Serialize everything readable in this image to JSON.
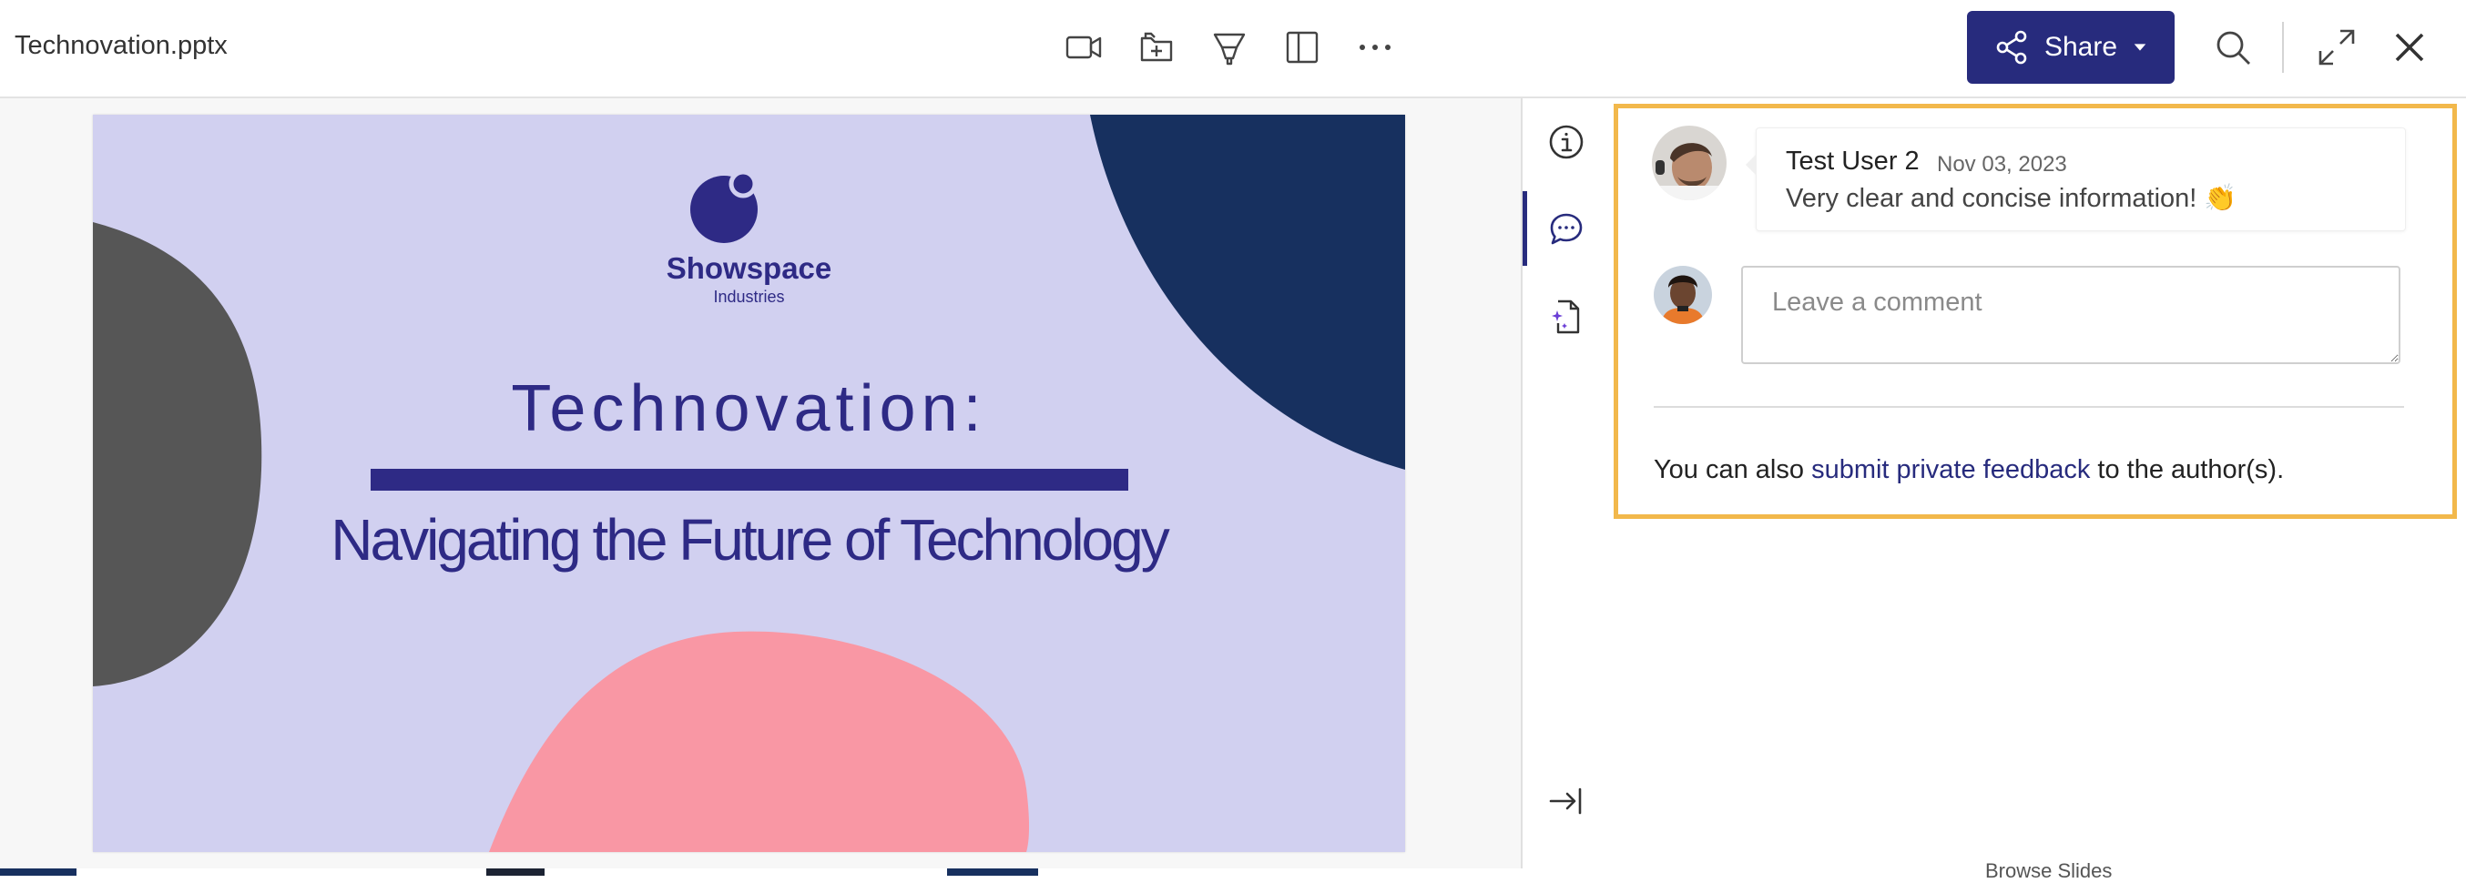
{
  "header": {
    "filename": "Technovation.pptx",
    "toolbar": [
      {
        "name": "video-icon"
      },
      {
        "name": "add-to-folder-icon"
      },
      {
        "name": "highlighter-icon"
      },
      {
        "name": "side-panel-icon"
      },
      {
        "name": "more-icon"
      }
    ],
    "share_label": "Share",
    "colors": {
      "share_bg": "#272b7d"
    }
  },
  "slide": {
    "logo_name": "Showspace",
    "logo_sub": "Industries",
    "title": "Technovation:",
    "subtitle": "Navigating the Future of Technology",
    "colors": {
      "background": "#d1d0f0",
      "navy": "#17305f",
      "gray": "#565656",
      "pink": "#f997a4",
      "text": "#2e2a85"
    }
  },
  "rail": {
    "items": [
      "info-icon",
      "comments-icon",
      "ai-document-icon"
    ],
    "active": "comments-icon",
    "collapse": "collapse-panel-icon"
  },
  "comments": {
    "items": [
      {
        "author": "Test User 2",
        "date": "Nov 03, 2023",
        "text": "Very clear and concise information! 👏"
      }
    ],
    "input_placeholder": "Leave a comment",
    "feedback_prefix": "You can also ",
    "feedback_link": "submit private feedback",
    "feedback_suffix": " to the author(s).",
    "highlight_color": "#f2b84b"
  },
  "footer": {
    "clipped_text": "Browse Slides"
  }
}
